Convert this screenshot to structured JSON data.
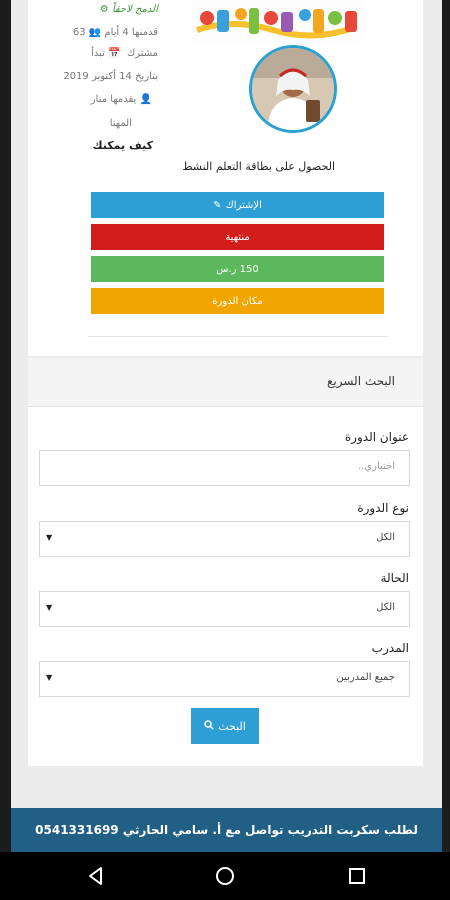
{
  "course_card": {
    "badge": "الدمج لاحقاً",
    "views": "63",
    "time_ago": "قدمنها 4 أيام",
    "starts": "تبدأ",
    "participant": "مشترك",
    "date": "بتاريخ 14 أكتوبر 2019",
    "presenter_prefix": "يقدمها منار",
    "presenter_name": "المهنا",
    "how": "كيف يمكنك",
    "headline": "الحصول على بطاقة التعلم النشط",
    "subscribe_label": "الإشتراك",
    "ended_label": "منتهية",
    "price_label": "150 ر.س",
    "place_label": "مكان الدورة"
  },
  "quick_search": {
    "title": "البحث السريع",
    "course_title_label": "عنوان الدورة",
    "course_title_placeholder": "اختياري..",
    "course_type_label": "نوع الدورة",
    "course_type_value": "الكل",
    "status_label": "الحالة",
    "status_value": "الكل",
    "trainer_label": "المدرب",
    "trainer_value": "جميع المدربين",
    "search_button": "البحث"
  },
  "footer": {
    "text": "لطلب سكربت التدريب تواصل مع أ. سامي الحارثي 0541331699"
  },
  "colors": {
    "primary": "#2e9fd4",
    "danger": "#d31d1d",
    "success": "#5cb85c",
    "warning": "#f0a500",
    "footer": "#215f85"
  }
}
